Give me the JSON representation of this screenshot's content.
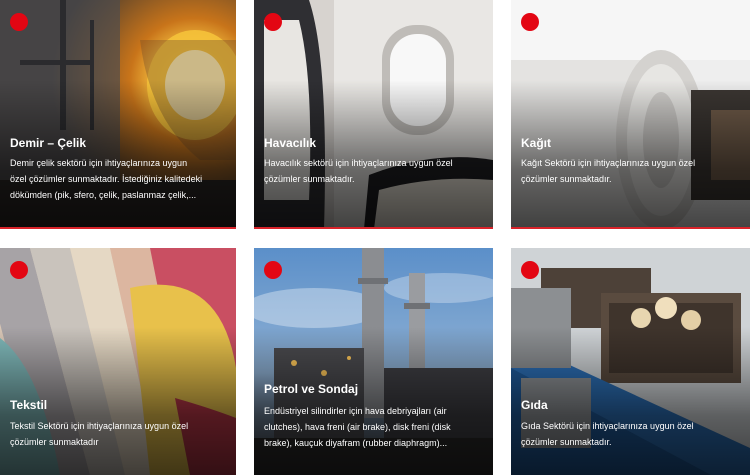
{
  "cards": [
    {
      "title": "Demir – Çelik",
      "description": "Demir çelik sektörü için ihtiyaçlarınıza uygun\nözel çözümler sunmaktadır. İstediğiniz kalitedeki\ndökümden (pik, sfero, çelik, paslanmaz çelik,..."
    },
    {
      "title": "Havacılık",
      "description": "Havacılık sektörü için ihtiyaçlarınıza uygun özel\nçözümler sunmaktadır."
    },
    {
      "title": "Kağıt",
      "description": "Kağıt Sektörü için ihtiyaçlarınıza uygun özel\nçözümler sunmaktadır."
    },
    {
      "title": "Tekstil",
      "description": "Tekstil Sektörü için ihtiyaçlarınıza uygun özel\nçözümler sunmaktadır"
    },
    {
      "title": "Petrol ve Sondaj",
      "description": "Endüstriyel silindirler için hava debriyajları (air\nclutches), hava freni (air brake), disk freni (disk\nbrake), kauçuk diyafram (rubber diaphragm)..."
    },
    {
      "title": "Gıda",
      "description": "Gıda Sektörü için ihtiyaçlarınıza uygun özel\nçözümler sunmaktadır."
    }
  ],
  "colors": {
    "accent_dot": "#e30613",
    "bottom_line": "#d8232a"
  }
}
